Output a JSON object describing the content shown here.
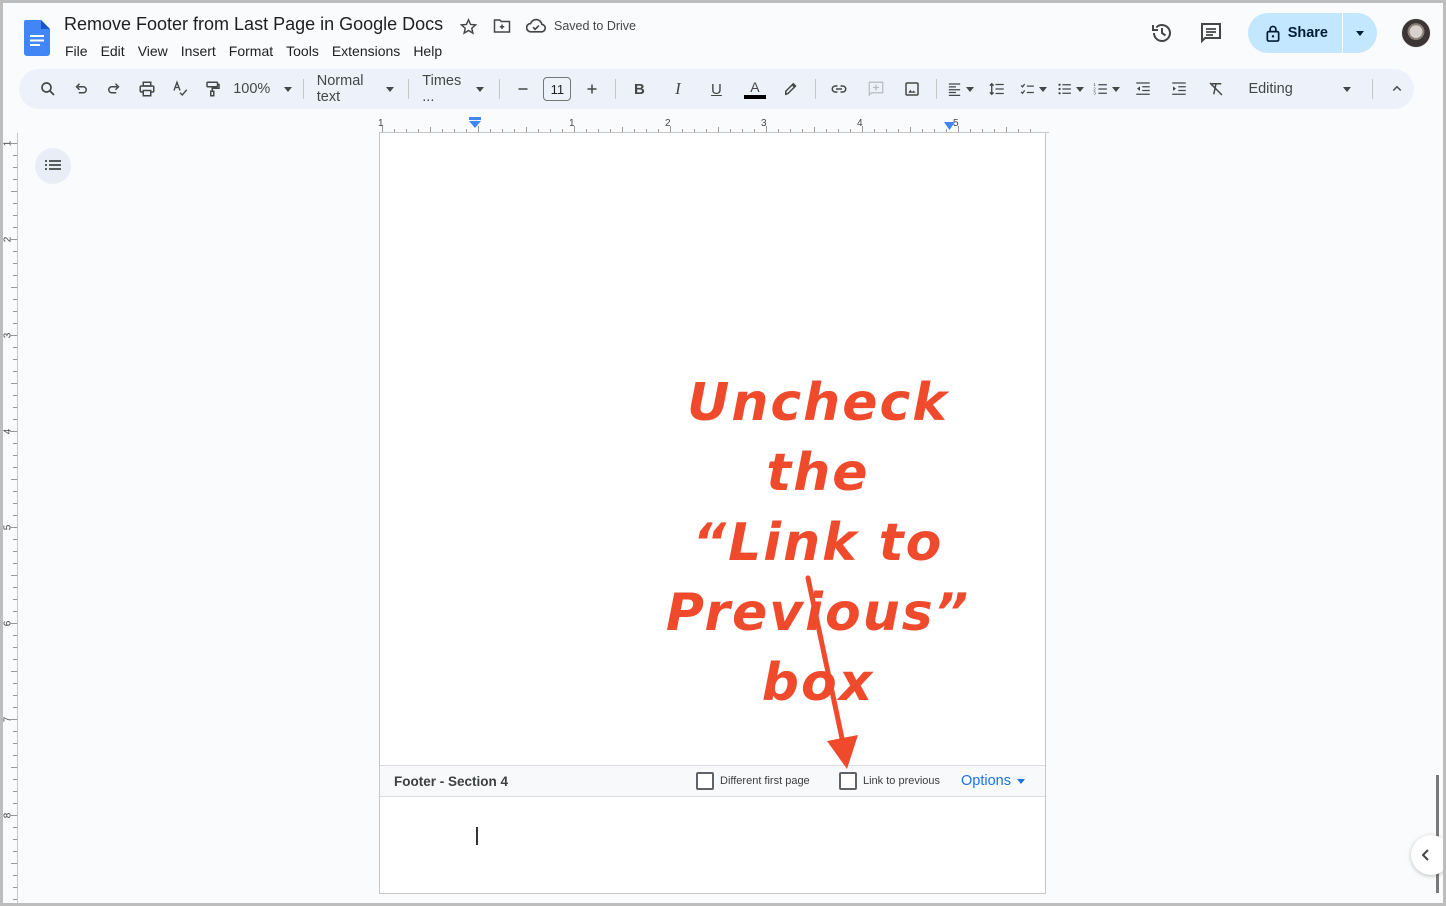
{
  "app": {
    "title": "Remove Footer from Last Page in Google Docs",
    "save_status": "Saved to Drive",
    "menu": [
      "File",
      "Edit",
      "View",
      "Insert",
      "Format",
      "Tools",
      "Extensions",
      "Help"
    ],
    "share_label": "Share",
    "brand_color": "#4285f4",
    "share_bg": "#c2e7ff"
  },
  "toolbar": {
    "zoom": "100%",
    "style": "Normal text",
    "font": "Times ...",
    "font_size": "11",
    "mode": "Editing",
    "icons": [
      "search-icon",
      "undo-icon",
      "redo-icon",
      "print-icon",
      "spellcheck-icon",
      "paint-format-icon",
      "bold-icon",
      "italic-icon",
      "underline-icon",
      "text-color-icon",
      "highlight-icon",
      "link-icon",
      "add-comment-icon",
      "insert-image-icon",
      "align-icon",
      "line-spacing-icon",
      "checklist-icon",
      "bulleted-list-icon",
      "numbered-list-icon",
      "decrease-indent-icon",
      "increase-indent-icon",
      "clear-formatting-icon",
      "pencil-icon",
      "collapse-icon"
    ]
  },
  "ruler": {
    "horizontal_labels": [
      "1",
      "1",
      "2",
      "3",
      "4",
      "5"
    ],
    "vertical_labels": [
      "1",
      "2",
      "3",
      "4",
      "5",
      "6",
      "7",
      "8"
    ]
  },
  "footer": {
    "title": "Footer - Section 4",
    "different_first_page": {
      "label": "Different first page",
      "checked": false
    },
    "link_to_previous": {
      "label": "Link to previous",
      "checked": false
    },
    "options_label": "Options"
  },
  "annotation": {
    "lines": [
      "Uncheck the",
      "“Link to",
      "Previous” box"
    ],
    "color": "#f04a2c"
  }
}
